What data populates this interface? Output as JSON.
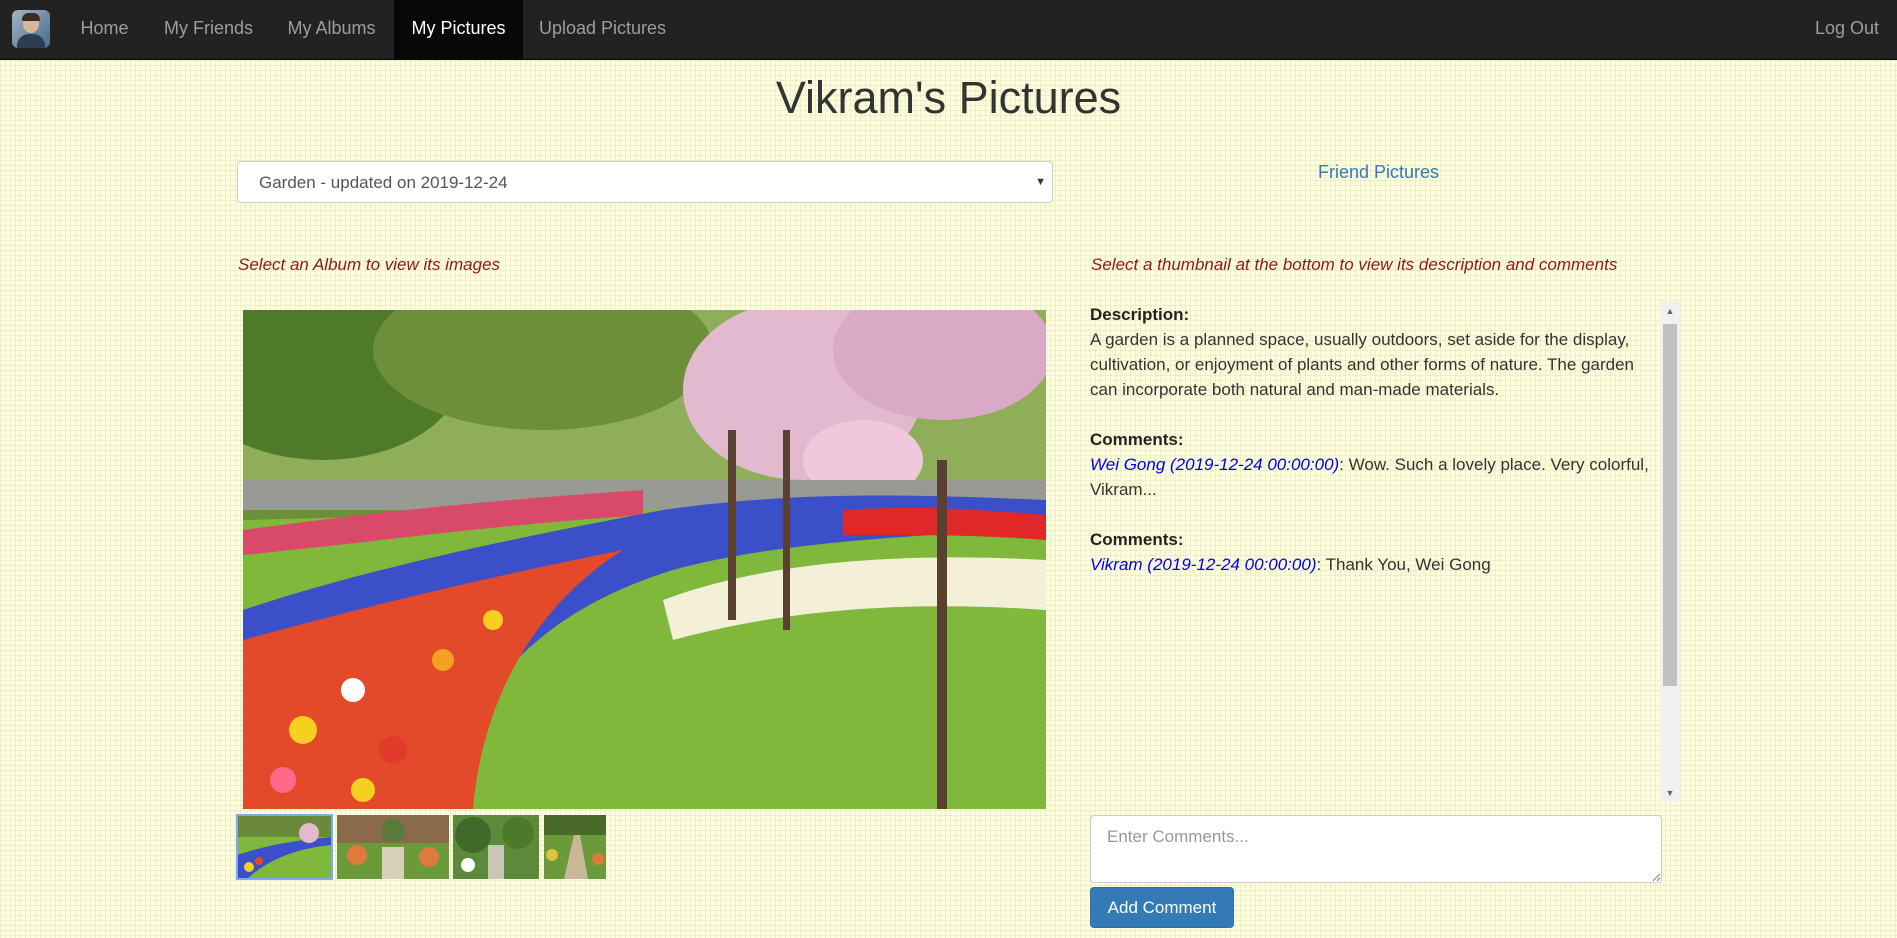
{
  "nav": {
    "items": [
      {
        "label": "Home",
        "active": false
      },
      {
        "label": "My Friends",
        "active": false
      },
      {
        "label": "My Albums",
        "active": false
      },
      {
        "label": "My Pictures",
        "active": true
      },
      {
        "label": "Upload Pictures",
        "active": false
      }
    ],
    "logout_label": "Log Out",
    "logo_icon": "user-avatar-icon"
  },
  "page": {
    "title": "Vikram's Pictures"
  },
  "album_select": {
    "selected": "Garden - updated on 2019-12-24"
  },
  "friend_pictures_link": "Friend Pictures",
  "hints": {
    "album": "Select an Album to view its images",
    "thumbnail": "Select a thumbnail at the bottom to view its description and comments"
  },
  "main_image": {
    "subject": "garden with tulips, blue hyacinth river and pink blossom trees"
  },
  "thumbnails": [
    {
      "subject": "garden tulips",
      "selected": true
    },
    {
      "subject": "walled garden",
      "selected": false
    },
    {
      "subject": "green garden with path",
      "selected": false
    },
    {
      "subject": "garden path with flowers",
      "selected": false
    }
  ],
  "details": {
    "description_label": "Description:",
    "description": "A garden is a planned space, usually outdoors, set aside for the display, cultivation, or enjoyment of plants and other forms of nature. The garden can incorporate both natural and man-made materials.",
    "comments": [
      {
        "label": "Comments:",
        "author": "Wei Gong (2019-12-24 00:00:00)",
        "text": ": Wow. Such a lovely place. Very colorful, Vikram..."
      },
      {
        "label": "Comments:",
        "author": "Vikram (2019-12-24 00:00:00)",
        "text": ": Thank You, Wei Gong"
      }
    ]
  },
  "comment_form": {
    "placeholder": "Enter Comments...",
    "value": "",
    "button_label": "Add Comment"
  },
  "colors": {
    "navbar": "#222222",
    "nav_active": "#080808",
    "link": "#337ab7",
    "hint": "#8b1a1a",
    "author": "#0000ee",
    "button": "#337ab7"
  }
}
